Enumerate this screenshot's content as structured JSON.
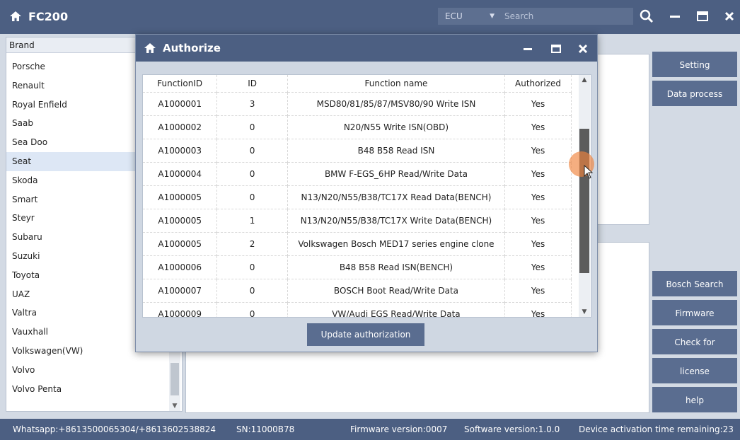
{
  "app": {
    "title": "FC200"
  },
  "toolbar": {
    "ecu_label": "ECU",
    "search_placeholder": "Search"
  },
  "brand": {
    "header": "Brand",
    "items": [
      "Porsche",
      "Renault",
      "Royal Enfield",
      "Saab",
      "Sea Doo",
      "Seat",
      "Skoda",
      "Smart",
      "Steyr",
      "Subaru",
      "Suzuki",
      "Toyota",
      "UAZ",
      "Valtra",
      "Vauxhall",
      "Volkswagen(VW)",
      "Volvo",
      "Volvo Penta"
    ],
    "selected": "Seat"
  },
  "side_buttons": {
    "setting": "Setting",
    "data_process": "Data process",
    "bosch_search": "Bosch Search",
    "firmware_upgrade": "Firmware upgrade",
    "check_updates": "Check for updates",
    "license": "license",
    "help": "help"
  },
  "dialog": {
    "title": "Authorize",
    "columns": [
      "FunctionID",
      "ID",
      "Function name",
      "Authorized"
    ],
    "rows": [
      [
        "A1000001",
        "3",
        "MSD80/81/85/87/MSV80/90 Write ISN",
        "Yes"
      ],
      [
        "A1000002",
        "0",
        "N20/N55 Write ISN(OBD)",
        "Yes"
      ],
      [
        "A1000003",
        "0",
        "B48 B58 Read ISN",
        "Yes"
      ],
      [
        "A1000004",
        "0",
        "BMW F-EGS_6HP Read/Write Data",
        "Yes"
      ],
      [
        "A1000005",
        "0",
        "N13/N20/N55/B38/TC17X Read Data(BENCH)",
        "Yes"
      ],
      [
        "A1000005",
        "1",
        "N13/N20/N55/B38/TC17X Write Data(BENCH)",
        "Yes"
      ],
      [
        "A1000005",
        "2",
        "Volkswagen Bosch MED17 series engine clone",
        "Yes"
      ],
      [
        "A1000006",
        "0",
        "B48 B58 Read ISN(BENCH)",
        "Yes"
      ],
      [
        "A1000007",
        "0",
        "BOSCH Boot Read/Write Data",
        "Yes"
      ],
      [
        "A1000009",
        "0",
        "VW/Audi EGS Read/Write Data",
        "Yes"
      ]
    ],
    "update_button": "Update authorization"
  },
  "status": {
    "whatsapp": "Whatsapp:+8613500065304/+8613602538824",
    "sn": "SN:11000B78",
    "firmware": "Firmware version:0007",
    "software": "Software version:1.0.0",
    "activation": "Device activation time remaining:23"
  }
}
